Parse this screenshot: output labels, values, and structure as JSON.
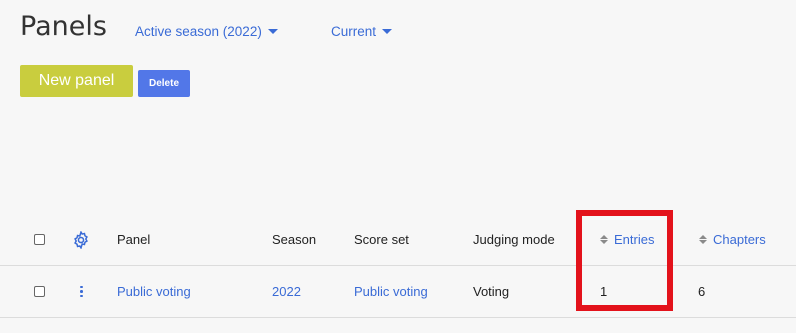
{
  "header": {
    "title": "Panels",
    "filters": [
      {
        "label": "Active season (2022)"
      },
      {
        "label": "Current"
      }
    ]
  },
  "toolbar": {
    "new_label": "New panel",
    "delete_label": "Delete"
  },
  "table": {
    "columns": [
      "Panel",
      "Season",
      "Score set",
      "Judging mode",
      "Entries",
      "Chapters"
    ],
    "rows": [
      {
        "panel": "Public voting",
        "season": "2022",
        "score_set": "Public voting",
        "judging_mode": "Voting",
        "entries": "1",
        "chapters": "6"
      }
    ]
  },
  "colors": {
    "accent": "#3a6bd6",
    "new_button": "#c9cd3e",
    "delete_button": "#5277e8",
    "highlight": "#e3121b"
  },
  "icons": [
    "chevron-down-icon",
    "gear-icon",
    "sort-icon",
    "more-vertical-icon"
  ]
}
